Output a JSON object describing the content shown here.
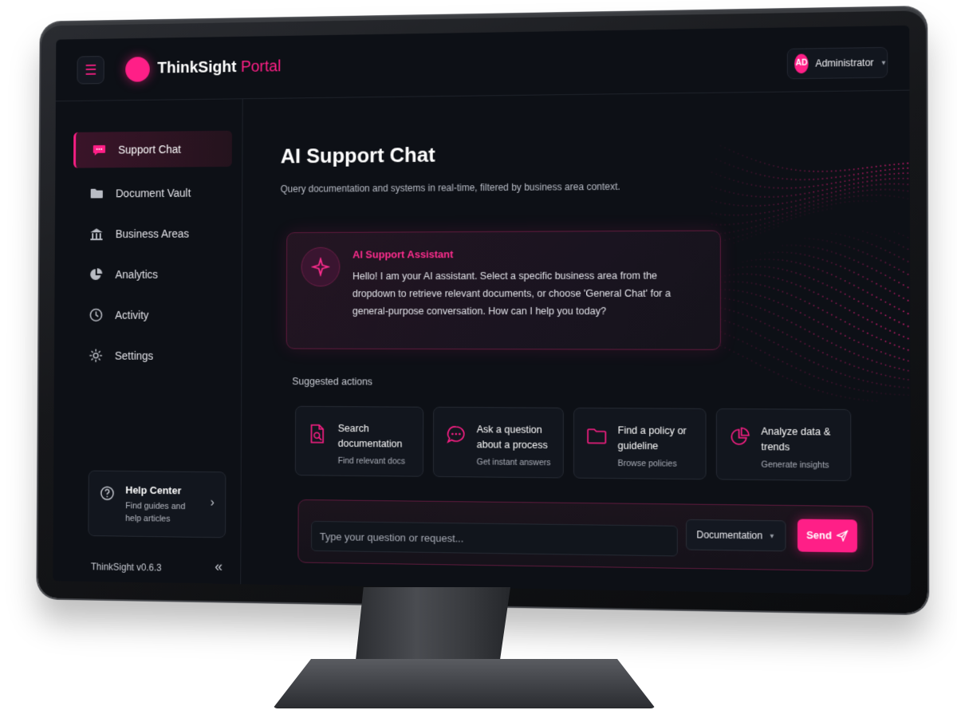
{
  "brand": {
    "name": "ThinkSight",
    "suffix": "Portal"
  },
  "user": {
    "initials": "AD",
    "name": "Administrator"
  },
  "sidebar": {
    "items": [
      {
        "label": "Support Chat",
        "icon": "chat-bubble-icon",
        "active": true
      },
      {
        "label": "Document Vault",
        "icon": "folder-icon",
        "active": false
      },
      {
        "label": "Business Areas",
        "icon": "building-icon",
        "active": false
      },
      {
        "label": "Analytics",
        "icon": "pie-chart-icon",
        "active": false
      },
      {
        "label": "Activity",
        "icon": "clock-icon",
        "active": false
      },
      {
        "label": "Settings",
        "icon": "gear-icon",
        "active": false
      }
    ],
    "help": {
      "title": "Help Center",
      "subtitle": "Find guides and help articles"
    },
    "version": "ThinkSight v0.6.3"
  },
  "main": {
    "title": "AI Support Chat",
    "subtitle": "Query documentation and systems in real-time, filtered by business area context.",
    "assistant": {
      "name": "AI Support Assistant",
      "message": "Hello! I am your AI assistant. Select a specific business area from the dropdown to retrieve relevant documents, or choose 'General Chat' for a general-purpose conversation. How can I help you today?"
    },
    "suggested_label": "Suggested actions",
    "actions": [
      {
        "title": "Search documentation",
        "subtitle": "Find relevant docs",
        "icon": "document-search-icon"
      },
      {
        "title": "Ask a question about a process",
        "subtitle": "Get instant answers",
        "icon": "chat-dots-icon"
      },
      {
        "title": "Find a policy or guideline",
        "subtitle": "Browse policies",
        "icon": "folder-icon"
      },
      {
        "title": "Analyze data & trends",
        "subtitle": "Generate insights",
        "icon": "pie-chart-icon"
      }
    ],
    "input": {
      "placeholder": "Type your question or request...",
      "value": ""
    },
    "area_select": {
      "selected": "Documentation"
    },
    "send_label": "Send"
  },
  "colors": {
    "accent": "#ff1f87",
    "background": "#0d1016",
    "panel": "#12161e"
  }
}
